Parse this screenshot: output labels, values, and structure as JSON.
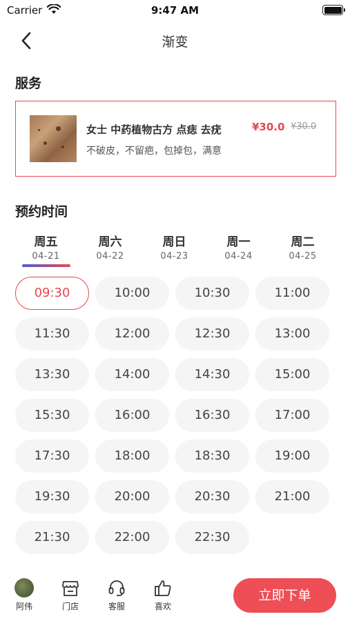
{
  "status_bar": {
    "carrier": "Carrier",
    "time": "9:47 AM",
    "icons": [
      "wifi-icon",
      "battery-icon"
    ]
  },
  "nav": {
    "title": "渐变",
    "back_icon": "chevron-left-icon"
  },
  "service": {
    "section_title": "服务",
    "name": "女士  中药植物古方 点痣 去疣",
    "price": "¥30.0",
    "original_price": "¥30.0",
    "description": "不破皮，不留疤，包掉包，满意"
  },
  "booking": {
    "section_title": "预约时间",
    "days": [
      {
        "name": "周五",
        "date": "04-21",
        "selected": true
      },
      {
        "name": "周六",
        "date": "04-22",
        "selected": false
      },
      {
        "name": "周日",
        "date": "04-23",
        "selected": false
      },
      {
        "name": "周一",
        "date": "04-24",
        "selected": false
      },
      {
        "name": "周二",
        "date": "04-25",
        "selected": false
      }
    ],
    "selected_time": "09:30",
    "times": [
      "09:30",
      "10:00",
      "10:30",
      "11:00",
      "11:30",
      "12:00",
      "12:30",
      "13:00",
      "13:30",
      "14:00",
      "14:30",
      "15:00",
      "15:30",
      "16:00",
      "16:30",
      "17:00",
      "17:30",
      "18:00",
      "18:30",
      "19:00",
      "19:30",
      "20:00",
      "20:30",
      "21:00",
      "21:30",
      "22:00",
      "22:30"
    ]
  },
  "bottom_bar": {
    "tabs": [
      {
        "label": "阿伟",
        "icon": "avatar"
      },
      {
        "label": "门店",
        "icon": "store-icon"
      },
      {
        "label": "客服",
        "icon": "headset-icon"
      },
      {
        "label": "喜欢",
        "icon": "thumbs-up-icon"
      }
    ],
    "order_button": "立即下单"
  },
  "colors": {
    "accent": "#e8484f",
    "gradient_start": "#4d5cd8",
    "slot_bg": "#f5f5f5"
  }
}
